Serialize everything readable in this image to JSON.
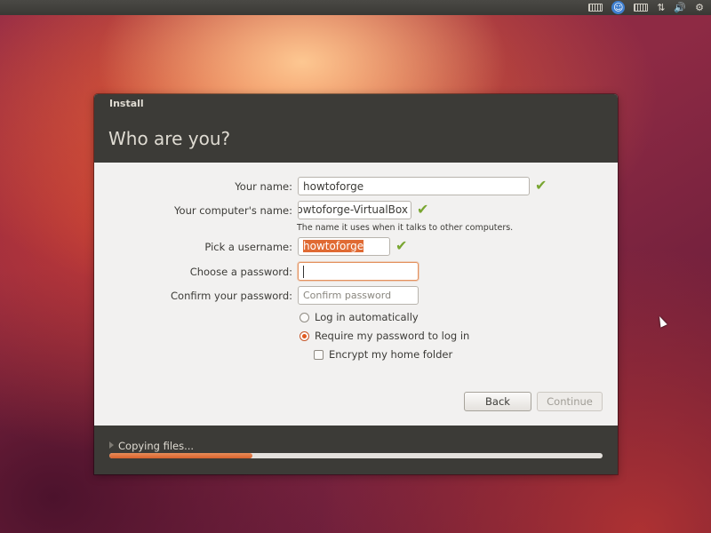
{
  "window": {
    "title": "Install",
    "heading": "Who are you?"
  },
  "form": {
    "name_label": "Your name:",
    "name_value": "howtoforge",
    "computer_label": "Your computer's name:",
    "computer_value": "howtoforge-VirtualBox",
    "computer_hint": "The name it uses when it talks to other computers.",
    "username_label": "Pick a username:",
    "username_value": "howtoforge",
    "password_label": "Choose a password:",
    "password_value": "",
    "confirm_label": "Confirm your password:",
    "confirm_placeholder": "Confirm password",
    "check_mark": "✔"
  },
  "login_options": {
    "auto_label": "Log in automatically",
    "auto_selected": false,
    "require_label": "Require my password to log in",
    "require_selected": true,
    "encrypt_label": "Encrypt my home folder",
    "encrypt_checked": false
  },
  "buttons": {
    "back": "Back",
    "continue": "Continue"
  },
  "progress": {
    "status": "Copying files...",
    "fraction": 0.29
  },
  "top_panel": {
    "icons": [
      "keyboard-icon",
      "accessibility-icon",
      "keyboard-layout-icon",
      "network-icon",
      "volume-icon",
      "gear-icon"
    ],
    "accessibility_glyph": "☺",
    "network_glyph": "⇅",
    "volume_glyph": "🔊",
    "gear_glyph": "⚙"
  },
  "colors": {
    "accent": "#dd4814",
    "titlebar": "#3c3b37",
    "valid_check": "#79a631"
  }
}
